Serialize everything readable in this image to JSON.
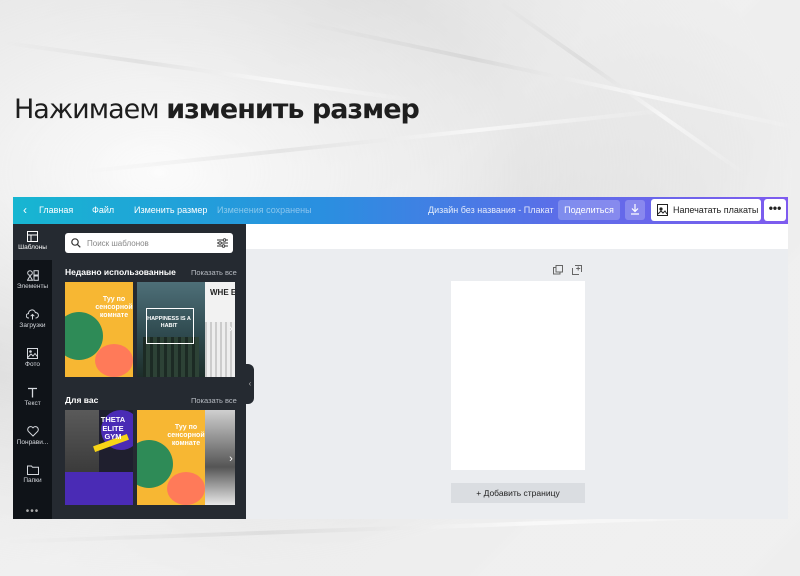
{
  "heading": {
    "normal": "Нажимаем ",
    "bold": "изменить размер"
  },
  "topbar": {
    "back_icon": "chevron-left-icon",
    "home": "Главная",
    "file": "Файл",
    "resize": "Изменить размер",
    "saved_status": "Изменения сохранены",
    "design_title": "Дизайн без названия - Плакат",
    "share": "Поделиться",
    "download_icon": "download-icon",
    "print": "Напечатать плакаты",
    "more": "•••"
  },
  "rail": {
    "items": [
      {
        "label": "Шаблоны",
        "icon": "templates-icon"
      },
      {
        "label": "Элементы",
        "icon": "elements-icon"
      },
      {
        "label": "Загрузки",
        "icon": "upload-cloud-icon"
      },
      {
        "label": "Фото",
        "icon": "photo-icon"
      },
      {
        "label": "Текст",
        "icon": "text-icon"
      },
      {
        "label": "Понрави...",
        "icon": "heart-icon"
      },
      {
        "label": "Папки",
        "icon": "folder-icon"
      }
    ],
    "more": "•••"
  },
  "panel": {
    "search_placeholder": "Поиск шаблонов",
    "recent": {
      "title": "Недавно использованные",
      "show_all": "Показать все",
      "thumbs": [
        {
          "text": "Туу по сенсорной комнате",
          "accent": "#f7b733"
        },
        {
          "text": "HAPPINESS IS A HABIT",
          "accent": "#3c5a62"
        },
        {
          "text": "WHE ELE",
          "accent": "#f2f2f2"
        }
      ]
    },
    "for_you": {
      "title": "Для вас",
      "show_all": "Показать все",
      "thumbs": [
        {
          "text": "THETA ELITE GYM",
          "accent": "#4a2bb5"
        },
        {
          "text": "Туу по сенсорной комнате",
          "accent": "#f7b733"
        },
        {
          "text": "",
          "accent": "#dcdcdc"
        }
      ]
    }
  },
  "canvas": {
    "add_page": "+ Добавить страницу"
  },
  "colors": {
    "brand_start": "#17b6d1",
    "brand_end": "#7e5bef",
    "dark_panel": "#252a31"
  }
}
